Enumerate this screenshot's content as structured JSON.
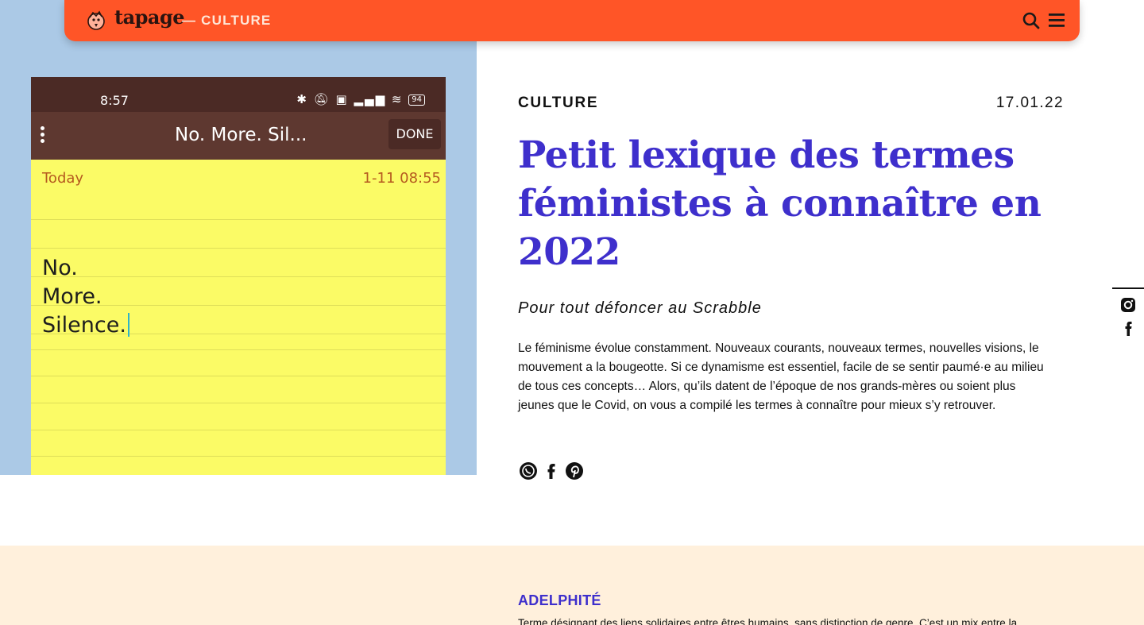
{
  "header": {
    "logo_text": "tapage",
    "section_label": "— CULTURE",
    "icons": [
      "bird-logo-icon",
      "search-icon",
      "hamburger-menu-icon"
    ],
    "color": "#ff5527"
  },
  "hero_image": {
    "status_time": "8:57",
    "battery": "94",
    "toolbar_title": "No. More. Sil...",
    "done_label": "DONE",
    "note_date": "Today",
    "note_timestamp": "1-11 08:55",
    "note_lines": [
      "No.",
      "More.",
      "Silence."
    ],
    "icons": [
      "bluetooth-icon",
      "mute-icon",
      "volte-icon",
      "signal-icon",
      "wifi-icon",
      "battery-icon",
      "overflow-menu-icon"
    ],
    "colors": {
      "background": "#abc9e6",
      "paper": "#fbfb66",
      "toolbar": "#5e3830"
    }
  },
  "article": {
    "category": "CULTURE",
    "date": "17.01.22",
    "title": "Petit lexique des termes féministes à connaître en 2022",
    "subtitle": "Pour tout défoncer au Scrabble",
    "intro": "Le féminisme évolue constamment. Nouveaux courants, nouveaux termes, nouvelles visions, le mouvement a la bougeotte. Si ce dynamisme est essentiel, facile de se sentir paumé·e au milieu de tous ces concepts… Alors, qu’ils datent de l’époque de nos grands-mères ou soient plus jeunes que le Covid, on vous a compilé les termes à connaître pour mieux s’y retrouver.",
    "share_icons": [
      "whatsapp-icon",
      "facebook-icon",
      "pinterest-icon"
    ],
    "title_color": "#3e2fcc"
  },
  "side_social": {
    "icons": [
      "instagram-icon",
      "facebook-icon"
    ]
  },
  "lexicon": {
    "term": "ADELPHITÉ",
    "definition_preview": "Terme désignant des liens solidaires entre êtres humains, sans distinction de genre. C’est un mix entre la",
    "background": "#fff0dc"
  }
}
